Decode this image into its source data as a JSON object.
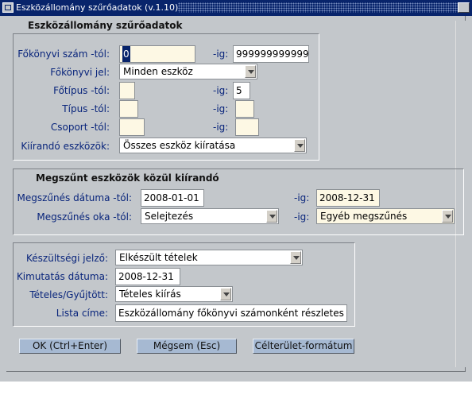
{
  "window": {
    "title": "Eszközállomány szűrőadatok (v.1.10)"
  },
  "section1": {
    "title": "Eszközállomány szűrőadatok",
    "fokonyvi_szam": {
      "label": "Főkönyvi szám -tól:",
      "from": "0",
      "to_label": "-ig:",
      "to": "999999999999"
    },
    "fokonyvi_jel": {
      "label": "Főkönyvi jel:",
      "value": "Minden eszköz"
    },
    "fotipus": {
      "label": "Főtípus -tól:",
      "from": "",
      "to_label": "-ig:",
      "to": "5"
    },
    "tipus": {
      "label": "Típus -tól:",
      "from": "",
      "to_label": "-ig:",
      "to": ""
    },
    "csoport": {
      "label": "Csoport -tól:",
      "from": "",
      "to_label": "-ig:",
      "to": ""
    },
    "kiirando": {
      "label": "Kiírandó eszközök:",
      "value": "Összes eszköz kiíratása"
    }
  },
  "section2": {
    "title": "Megszűnt eszközök közül kiírandó",
    "datum": {
      "label": "Megszűnés dátuma -tól:",
      "from": "2008-01-01",
      "to_label": "-ig:",
      "to": "2008-12-31"
    },
    "ok": {
      "label": "Megszűnés oka -tól:",
      "from": "Selejtezés",
      "to_label": "-ig:",
      "to": "Egyéb megszűnés"
    }
  },
  "section3": {
    "keszultsegi": {
      "label": "Készültségi jelző:",
      "value": "Elkészült tételek"
    },
    "kimutatas_datuma": {
      "label": "Kimutatás dátuma:",
      "value": "2008-12-31"
    },
    "teteles": {
      "label": "Tételes/Gyűjtött:",
      "value": "Tételes kiírás"
    },
    "lista_cime": {
      "label": "Lista címe:",
      "value": "Eszközállomány főkönyvi számonként részletes"
    }
  },
  "buttons": {
    "ok": "OK (Ctrl+Enter)",
    "cancel": "Mégsem (Esc)",
    "format": "Célterület-formátum"
  }
}
